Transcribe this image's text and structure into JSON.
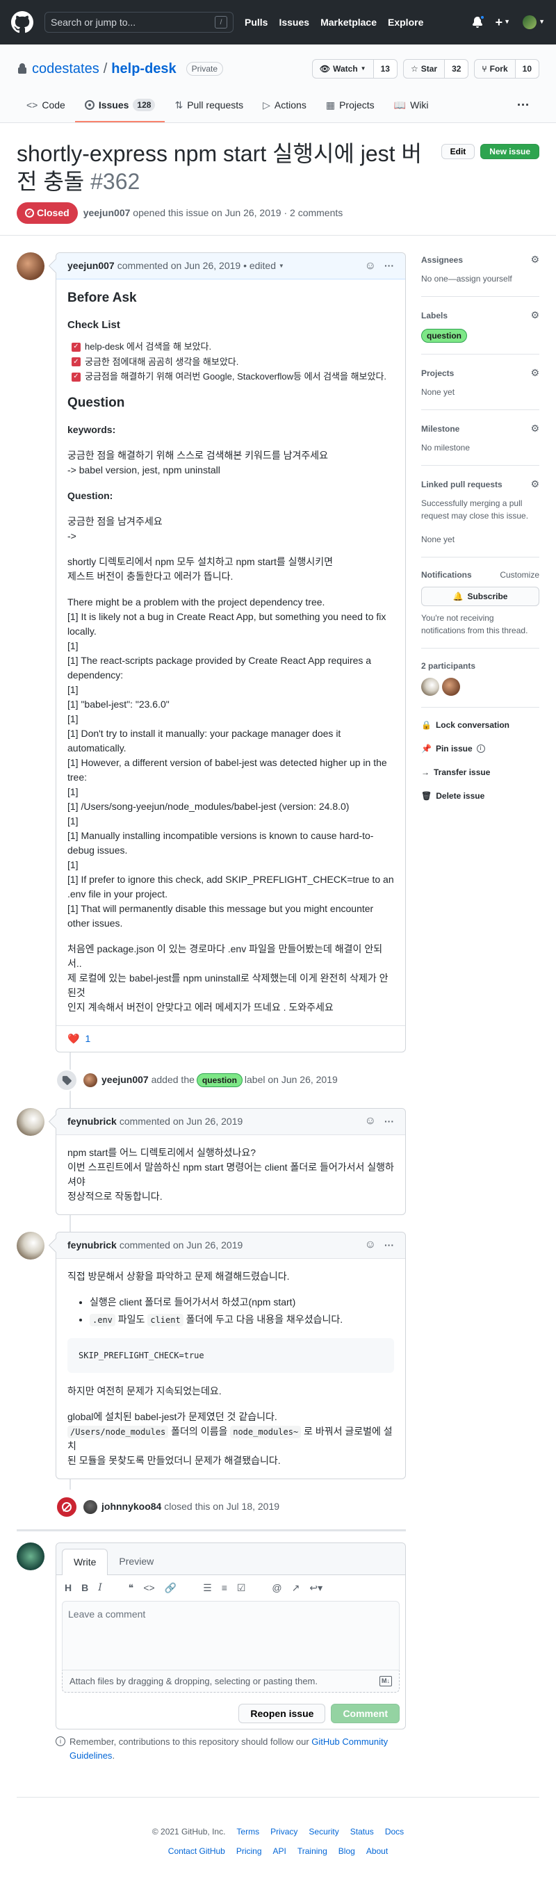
{
  "header": {
    "search_placeholder": "Search or jump to...",
    "slash_key": "/",
    "nav": [
      "Pulls",
      "Issues",
      "Marketplace",
      "Explore"
    ]
  },
  "repo": {
    "owner": "codestates",
    "separator": "/",
    "name": "help-desk",
    "visibility": "Private",
    "watch_label": "Watch",
    "watch_count": "13",
    "star_label": "Star",
    "star_count": "32",
    "fork_label": "Fork",
    "fork_count": "10",
    "tabs": {
      "code": "Code",
      "issues": "Issues",
      "issues_count": "128",
      "pulls": "Pull requests",
      "actions": "Actions",
      "projects": "Projects",
      "wiki": "Wiki"
    }
  },
  "issue": {
    "title": "shortly-express npm start 실행시에 jest 버전 충돌",
    "number": "#362",
    "edit_label": "Edit",
    "new_issue_label": "New issue",
    "state": "Closed",
    "author": "yeejun007",
    "meta": "opened this issue on Jun 26, 2019 · 2 comments"
  },
  "comment1": {
    "author": "yeejun007",
    "meta": "commented on Jun 26, 2019 • edited",
    "h_before_ask": "Before Ask",
    "h_checklist": "Check List",
    "checklist": [
      "help-desk 에서 검색을 해 보았다.",
      "궁금한 점에대해 곰곰히 생각을 해보았다.",
      "궁금점을 해결하기 위해 여러번 Google, Stackoverflow등 에서 검색을 해보았다."
    ],
    "h_question": "Question",
    "h_keywords": "keywords:",
    "keywords_1": "궁금한 점을 해결하기 위해 스스로 검색해본 키워드를 남겨주세요",
    "keywords_2": "-> babel version, jest, npm uninstall",
    "h_question2": "Question:",
    "q_1": "궁금한 점을 남겨주세요",
    "q_2": "->",
    "p1_1": "shortly 디렉토리에서 npm 모두 설치하고 npm start를 실행시키면",
    "p1_2": "제스트 버전이 충돌한다고 에러가 뜹니다.",
    "log": [
      "There might be a problem with the project dependency tree.",
      "[1] It is likely not a bug in Create React App, but something you need to fix locally.",
      "[1]",
      "[1] The react-scripts package provided by Create React App requires a dependency:",
      "[1]",
      "[1] \"babel-jest\": \"23.6.0\"",
      "[1]",
      "[1] Don't try to install it manually: your package manager does it automatically.",
      "[1] However, a different version of babel-jest was detected higher up in the tree:",
      "[1]",
      "[1] /Users/song-yeejun/node_modules/babel-jest (version: 24.8.0)",
      "[1]",
      "[1] Manually installing incompatible versions is known to cause hard-to-debug issues.",
      "[1]",
      "[1] If prefer to ignore this check, add SKIP_PREFLIGHT_CHECK=true to an .env file in your project.",
      "[1] That will permanently disable this message but you might encounter other issues."
    ],
    "p_last_1": "처음엔 package.json 이 있는 경로마다 .env 파일을 만들어봤는데 해결이 안되서..",
    "p_last_2": "제 로컬에 있는 babel-jest를 npm uninstall로 삭제했는데 이게 완전히 삭제가 안된것",
    "p_last_3": "인지 계속해서 버전이 안맞다고 에러 메세지가 뜨네요 . 도와주세요",
    "reaction_count": "1"
  },
  "event_label": {
    "actor": "yeejun007",
    "pre": "added the",
    "label": "question",
    "post": "label on Jun 26, 2019"
  },
  "comment2": {
    "author": "feynubrick",
    "meta": "commented on Jun 26, 2019",
    "p1": "npm start를 어느 디렉토리에서 실행하셨나요?",
    "p2": "이번 스프린트에서 말씀하신 npm start 명령어는 client 폴더로 들어가서서 실행하셔야",
    "p3": "정상적으로 작동합니다."
  },
  "comment3": {
    "author": "feynubrick",
    "meta": "commented on Jun 26, 2019",
    "p1": "직접 방문해서 상황을 파악하고 문제 해결해드렸습니다.",
    "li1": "실행은 client 폴더로 들어가서서 하셨고(npm start)",
    "li2_code1": ".env",
    "li2_mid": " 파일도 ",
    "li2_code2": "client",
    "li2_end": " 폴더에 두고 다음 내용을 채우셨습니다.",
    "code": "SKIP_PREFLIGHT_CHECK=true",
    "p2": "하지만 여전히 문제가 지속되었는데요.",
    "p3": "global에 설치된 babel-jest가 문제였던 것 같습니다.",
    "p4_code1": "/Users/node_modules",
    "p4_mid": " 폴더의 이름을 ",
    "p4_code2": "node_modules~",
    "p4_end": " 로 바꿔서 글로벌에 설치",
    "p5": "된 모듈을 못찾도록 만들었더니 문제가 해결됐습니다."
  },
  "event_closed": {
    "actor": "johnnykoo84",
    "text": "closed this on Jul 18, 2019"
  },
  "editor": {
    "tab_write": "Write",
    "tab_preview": "Preview",
    "placeholder": "Leave a comment",
    "attach": "Attach files by dragging & dropping, selecting or pasting them.",
    "reopen": "Reopen issue",
    "comment": "Comment",
    "note_pre": "Remember, contributions to this repository should follow our",
    "note_link": "GitHub Community Guidelines",
    "note_post": "."
  },
  "sidebar": {
    "assignees_title": "Assignees",
    "assignees_text": "No one—assign yourself",
    "labels_title": "Labels",
    "label": "question",
    "projects_title": "Projects",
    "projects_text": "None yet",
    "milestone_title": "Milestone",
    "milestone_text": "No milestone",
    "linked_title": "Linked pull requests",
    "linked_text": "Successfully merging a pull request may close this issue.",
    "linked_none": "None yet",
    "notif_title": "Notifications",
    "notif_customize": "Customize",
    "subscribe": "Subscribe",
    "notif_text": "You're not receiving notifications from this thread.",
    "participants_title": "2 participants",
    "lock": "Lock conversation",
    "pin": "Pin issue",
    "transfer": "Transfer issue",
    "delete": "Delete issue"
  },
  "footer": {
    "copyright": "© 2021 GitHub, Inc.",
    "row1": [
      "Terms",
      "Privacy",
      "Security",
      "Status",
      "Docs"
    ],
    "row2": [
      "Contact GitHub",
      "Pricing",
      "API",
      "Training",
      "Blog",
      "About"
    ]
  },
  "colors": {
    "closed": "#d73a49",
    "accent": "#0366d6",
    "label_question": "#7ee787",
    "header_bg": "#24292e"
  }
}
